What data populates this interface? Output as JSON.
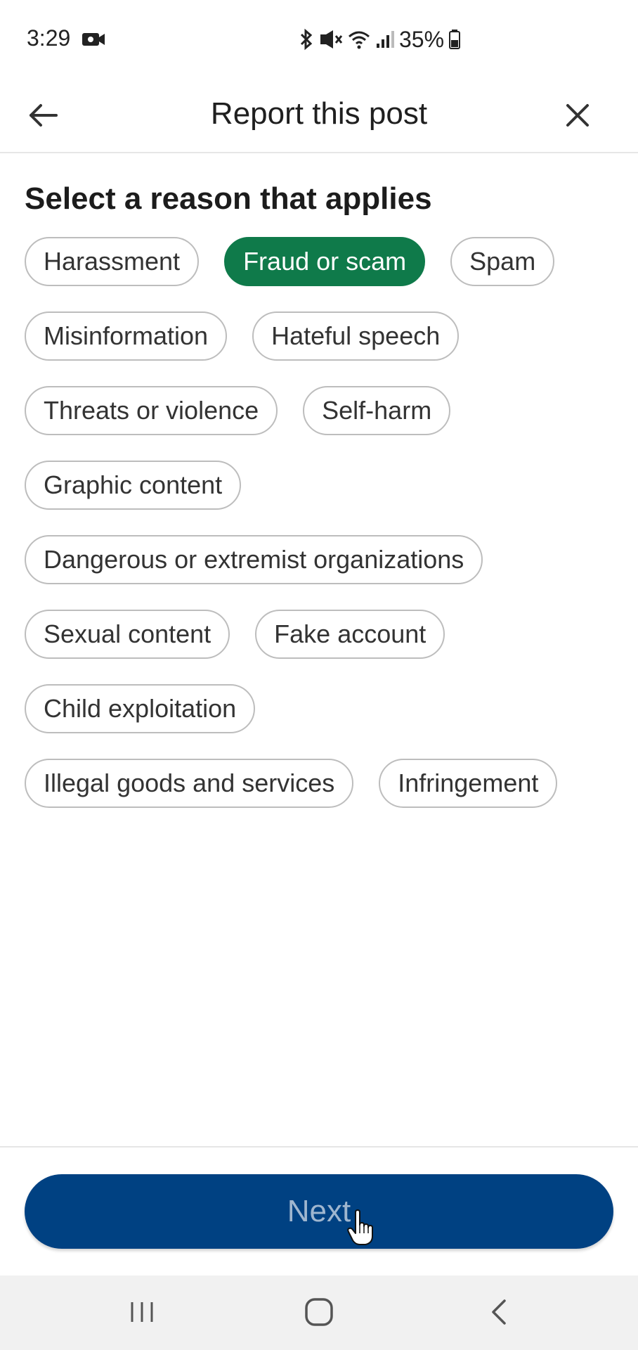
{
  "status_bar": {
    "time": "3:29",
    "battery": "35%"
  },
  "header": {
    "title": "Report this post"
  },
  "section_title": "Select a reason that applies",
  "reasons": [
    [
      "Harassment",
      "Fraud or scam",
      "Spam"
    ],
    [
      "Misinformation",
      "Hateful speech"
    ],
    [
      "Threats or violence",
      "Self-harm"
    ],
    [
      "Graphic content"
    ],
    [
      "Dangerous or extremist organizations"
    ],
    [
      "Sexual content",
      "Fake account"
    ],
    [
      "Child exploitation"
    ],
    [
      "Illegal goods and services",
      "Infringement"
    ]
  ],
  "selected_reason": "Fraud or scam",
  "next_label": "Next",
  "colors": {
    "selected_chip": "#0f7a4a",
    "next_button": "#004182",
    "next_label": "#9fb6cf"
  },
  "icons": {
    "back": "arrow-left-icon",
    "close": "close-icon",
    "cursor": "hand-pointer-icon"
  }
}
